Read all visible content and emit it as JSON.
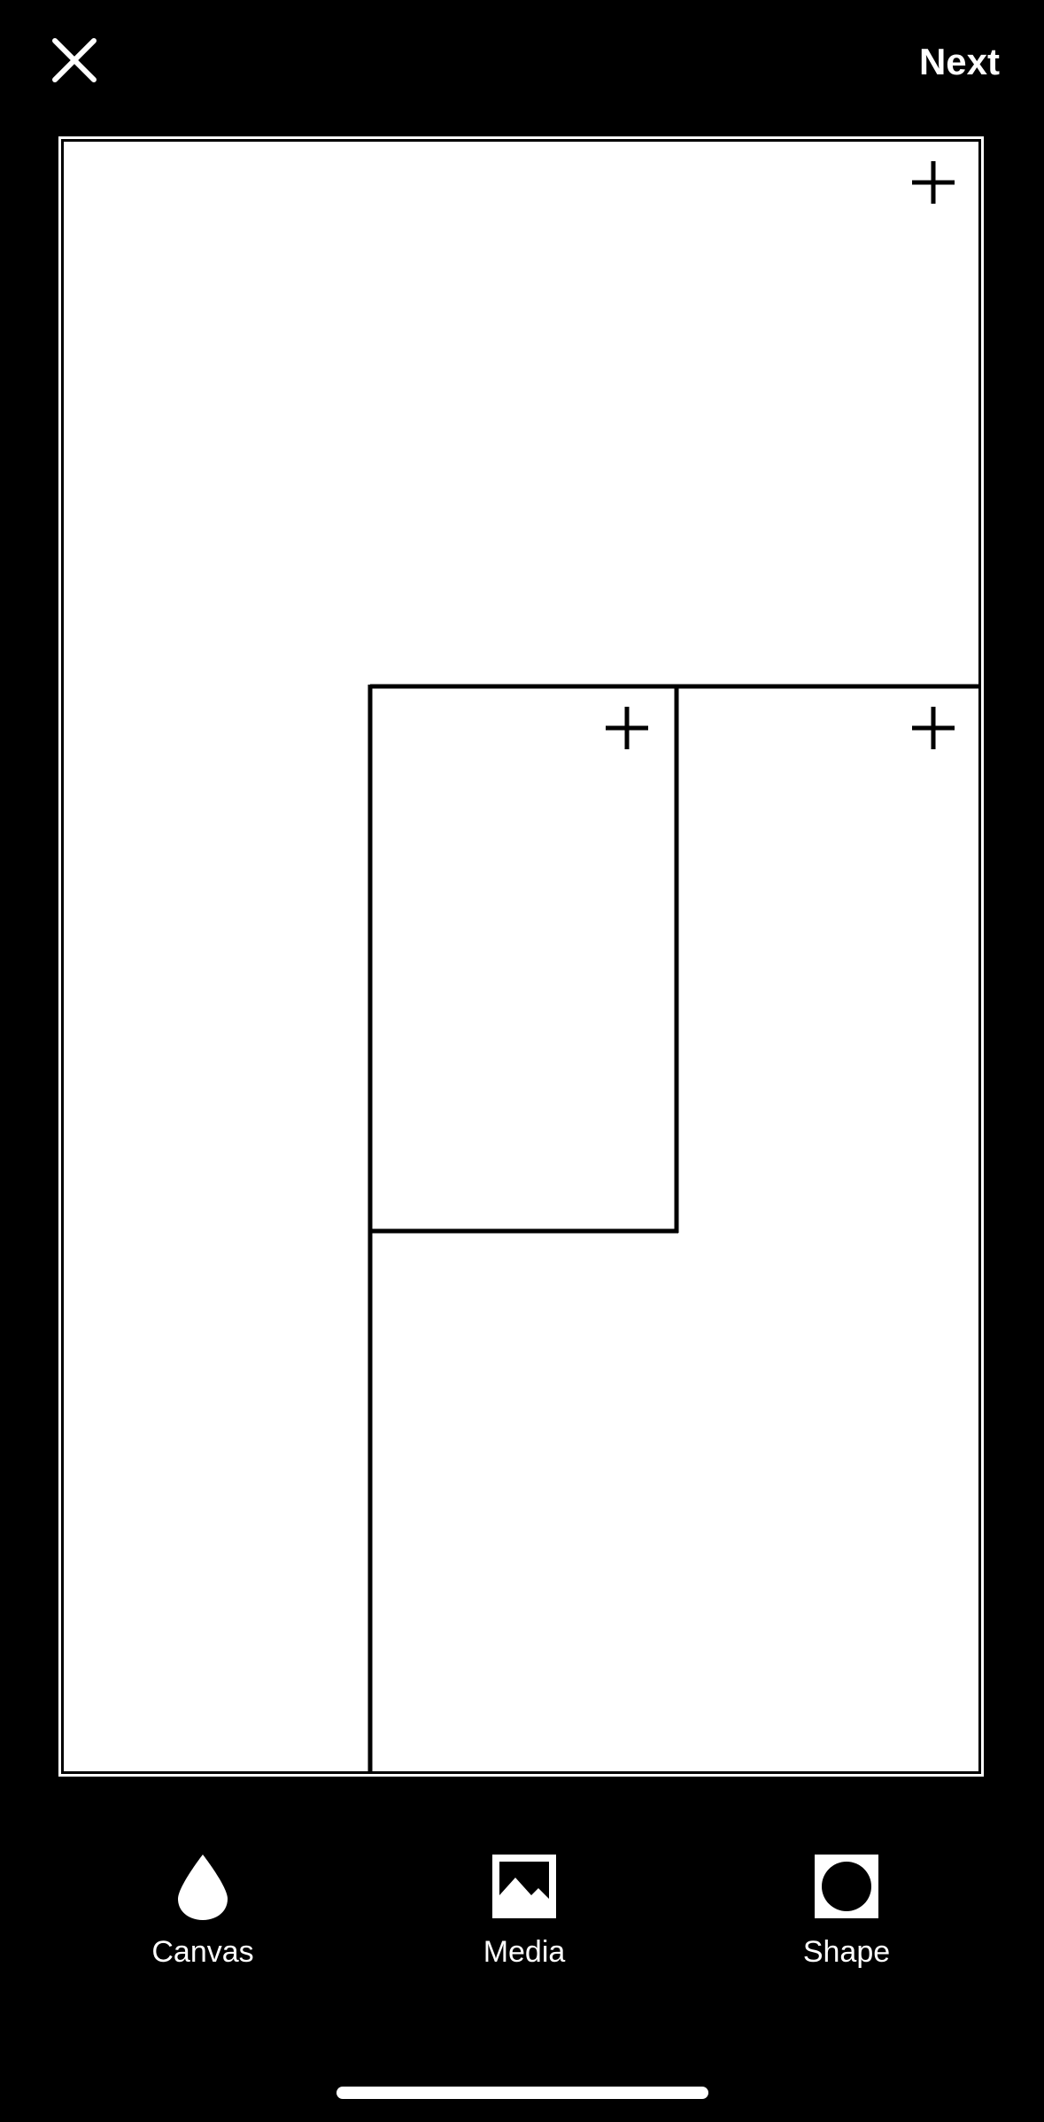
{
  "header": {
    "close_icon": "close-icon",
    "next_label": "Next"
  },
  "canvas": {
    "background_color": "#ffffff",
    "cells": [
      {
        "id": "top-cell",
        "add_icon": "plus-icon"
      },
      {
        "id": "middle-cell",
        "add_icon": "plus-icon"
      },
      {
        "id": "right-cell",
        "add_icon": "plus-icon"
      },
      {
        "id": "left-cell"
      },
      {
        "id": "bottom-cell"
      }
    ]
  },
  "toolbar": {
    "items": [
      {
        "label": "Canvas",
        "icon": "droplet-icon"
      },
      {
        "label": "Media",
        "icon": "image-icon"
      },
      {
        "label": "Shape",
        "icon": "shape-icon"
      }
    ]
  },
  "colors": {
    "background": "#000000",
    "foreground": "#ffffff",
    "grid_lines": "#000000"
  }
}
